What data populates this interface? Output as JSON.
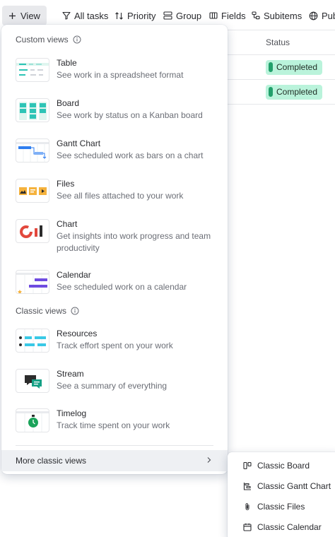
{
  "toolbar": {
    "view_label": "View",
    "items": [
      {
        "label": "All tasks",
        "icon": "filter-icon"
      },
      {
        "label": "Priority",
        "icon": "sort-icon"
      },
      {
        "label": "Group",
        "icon": "group-icon"
      },
      {
        "label": "Fields",
        "icon": "fields-icon"
      },
      {
        "label": "Subitems",
        "icon": "subitems-icon"
      },
      {
        "label": "Pub",
        "icon": "globe-icon"
      }
    ]
  },
  "table": {
    "status_header": "Status",
    "rows": [
      {
        "status": "Completed"
      },
      {
        "status": "Completed"
      }
    ],
    "status_color": "#baf3db"
  },
  "menu": {
    "custom_header": "Custom views",
    "custom_views": [
      {
        "title": "Table",
        "desc": "See work in a spreadsheet format",
        "icon": "table-thumbnail"
      },
      {
        "title": "Board",
        "desc": "See work by status on a Kanban board",
        "icon": "board-thumbnail"
      },
      {
        "title": "Gantt Chart",
        "desc": "See scheduled work as bars on a chart",
        "icon": "gantt-thumbnail"
      },
      {
        "title": "Files",
        "desc": "See all files attached to your work",
        "icon": "files-thumbnail"
      },
      {
        "title": "Chart",
        "desc": "Get insights into work progress and team productivity",
        "icon": "chart-thumbnail"
      },
      {
        "title": "Calendar",
        "desc": "See scheduled work on a calendar",
        "icon": "calendar-thumbnail"
      }
    ],
    "classic_header": "Classic views",
    "classic_views": [
      {
        "title": "Resources",
        "desc": "Track effort spent on your work",
        "icon": "resources-thumbnail"
      },
      {
        "title": "Stream",
        "desc": "See a summary of everything",
        "icon": "stream-thumbnail"
      },
      {
        "title": "Timelog",
        "desc": "Track time spent on your work",
        "icon": "timelog-thumbnail"
      }
    ],
    "more_label": "More classic views"
  },
  "submenu": {
    "items": [
      {
        "label": "Classic Board",
        "icon": "board-icon"
      },
      {
        "label": "Classic Gantt Chart",
        "icon": "gantt-icon"
      },
      {
        "label": "Classic Files",
        "icon": "paperclip-icon"
      },
      {
        "label": "Classic Calendar",
        "icon": "calendar-icon"
      }
    ]
  },
  "colors": {
    "accent_teal": "#2ec4b6",
    "accent_purple": "#6e4be0",
    "accent_yellow": "#f5b23c",
    "accent_red": "#e2483d",
    "accent_blue": "#2f7ef0"
  }
}
